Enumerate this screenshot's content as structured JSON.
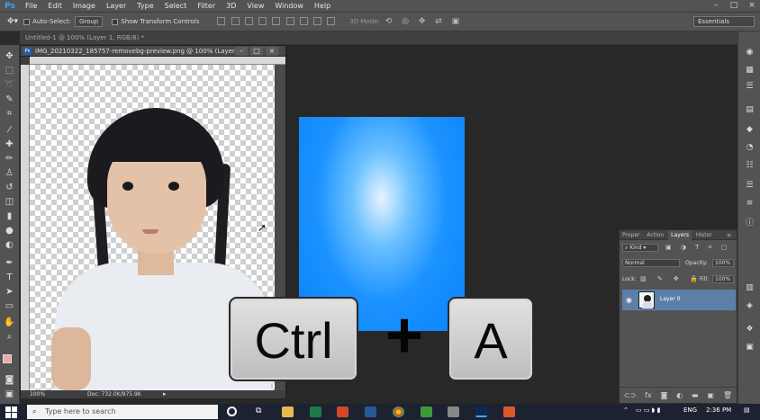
{
  "app": {
    "logo": "Ps",
    "menu": [
      "File",
      "Edit",
      "Image",
      "Layer",
      "Type",
      "Select",
      "Filter",
      "3D",
      "View",
      "Window",
      "Help"
    ]
  },
  "options_bar": {
    "auto_select_label": "Auto-Select:",
    "auto_select_value": "Group",
    "show_transform_label": "Show Transform Controls",
    "mode_3d_label": "3D Mode:",
    "workspace": "Essentials"
  },
  "doc_tab": "Untitled-1 @ 100% (Layer 1, RGB/8) *",
  "doc_window": {
    "title": "IMG_20210322_185757-removebg-preview.png @ 100% (Layer ...",
    "zoom": "100%",
    "doc_size": "Doc: 732.0K/975.9K"
  },
  "shortcut_overlay": {
    "key1": "Ctrl",
    "plus": "+",
    "key2": "A"
  },
  "layers_panel": {
    "tabs": [
      "Proper",
      "Action",
      "Layers",
      "Histor"
    ],
    "active_tab": "Layers",
    "kind": "Kind",
    "blend_mode": "Normal",
    "opacity_label": "Opacity:",
    "opacity": "100%",
    "lock_label": "Lock:",
    "fill_label": "Fill:",
    "fill": "100%",
    "layer_name": "Layer 0"
  },
  "taskbar": {
    "search_placeholder": "Type here to search",
    "language": "ENG",
    "time": "2:36 PM"
  },
  "colors": {
    "accent_blue": "#0b84fb",
    "selected_layer": "#5c7fa8",
    "ps_blue": "#31a8ff"
  }
}
